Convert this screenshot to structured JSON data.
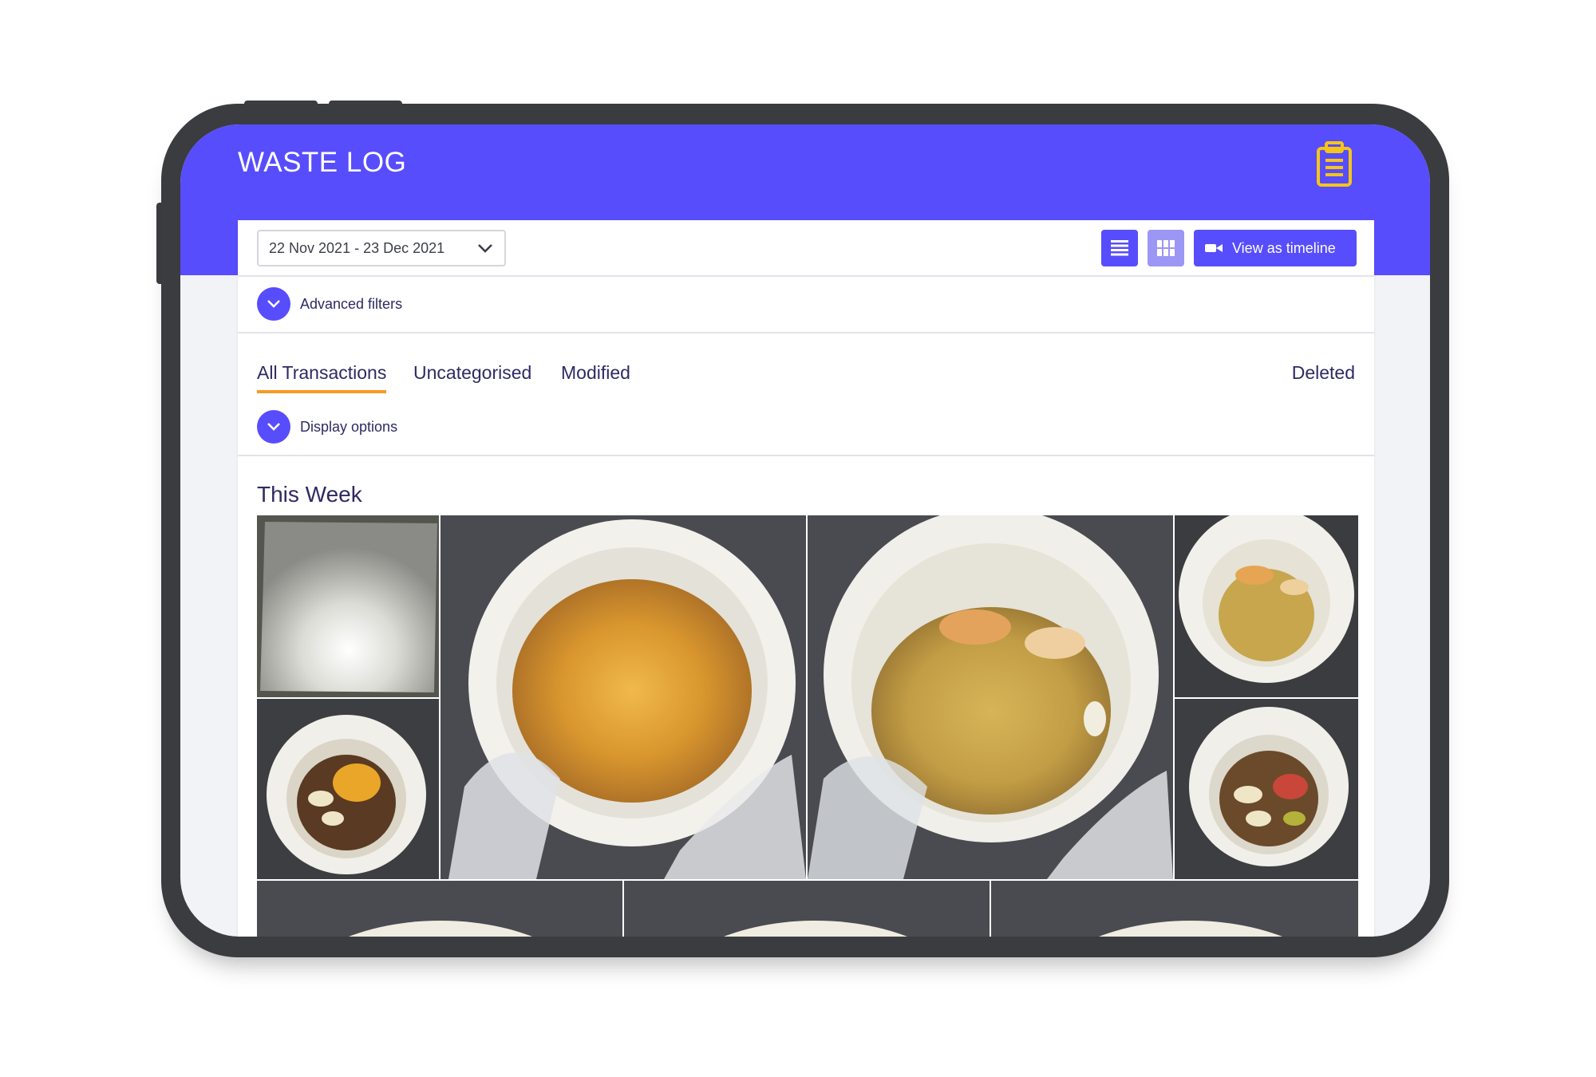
{
  "app": {
    "title": "WASTE LOG",
    "header_color": "#574dfc",
    "accent_color": "#f59a23",
    "header_icon": "clipboard-icon"
  },
  "filters": {
    "date_range": "22 Nov 2021 - 23 Dec 2021",
    "advanced_filters_label": "Advanced filters",
    "display_options_label": "Display options"
  },
  "toolbar": {
    "list_view_icon": "list-view-icon",
    "grid_view_icon": "grid-view-icon",
    "timeline_label": "View as timeline",
    "timeline_icon": "video-camera-icon"
  },
  "tabs": [
    {
      "label": "All Transactions",
      "active": true
    },
    {
      "label": "Uncategorised",
      "active": false
    },
    {
      "label": "Modified",
      "active": false
    },
    {
      "label": "Deleted",
      "active": false
    }
  ],
  "section": {
    "title": "This Week"
  },
  "photos": [
    {
      "content": "empty-stainless-tray"
    },
    {
      "content": "fries-in-bin"
    },
    {
      "content": "couscous-bread-in-bin"
    },
    {
      "content": "grain-bread-small-bin"
    },
    {
      "content": "mixed-food-small-bin"
    },
    {
      "content": "mixed-vegetables-small-bin"
    },
    {
      "content": "bin"
    },
    {
      "content": "bin"
    },
    {
      "content": "bin"
    }
  ]
}
